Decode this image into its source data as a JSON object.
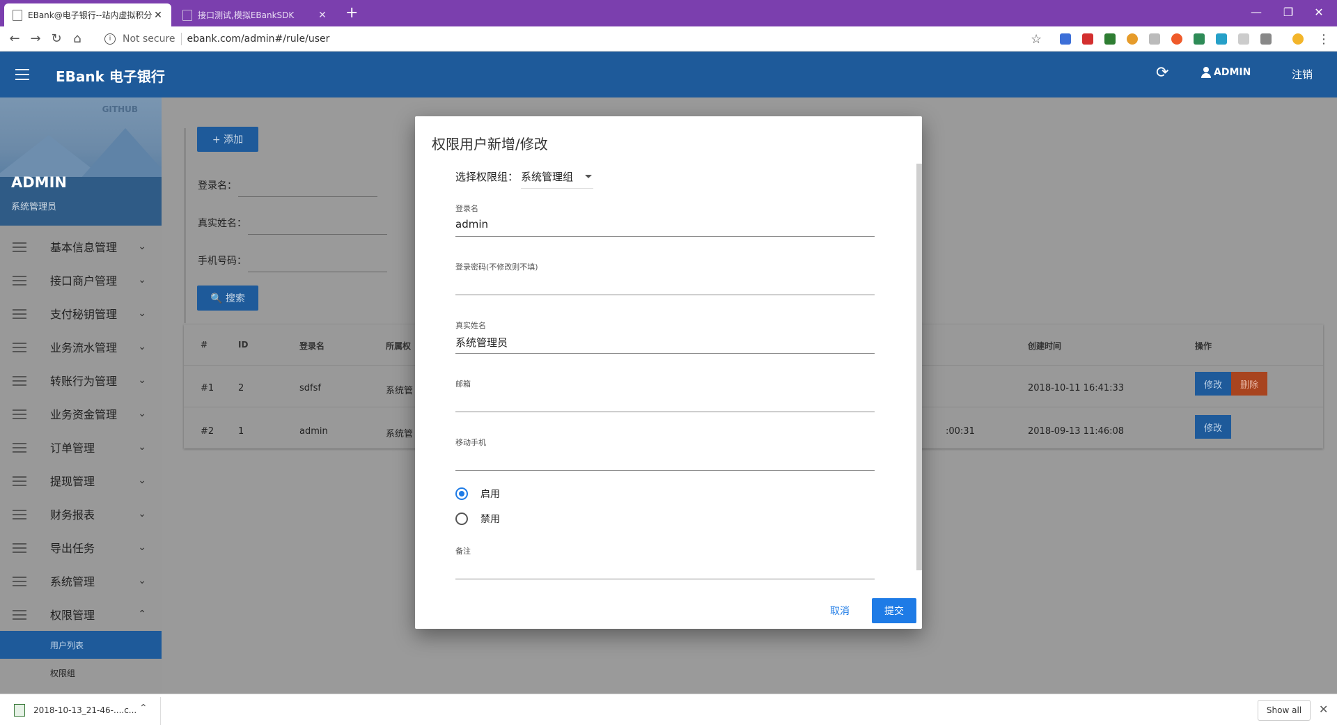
{
  "browser": {
    "tabs": [
      {
        "title": "EBank@电子银行--站内虚拟积分",
        "close": "✕"
      },
      {
        "title": "接口测试,模拟EBankSDK",
        "close": "✕"
      }
    ],
    "new_tab": "+",
    "window_controls": {
      "minimize": "—",
      "restore": "❐",
      "close": "✕"
    },
    "nav": {
      "back": "←",
      "forward": "→",
      "reload": "↻",
      "home": "⌂"
    },
    "security_label": "Not secure",
    "url": "ebank.com/admin#/rule/user",
    "bookmark_star": "☆",
    "menu": "⋮"
  },
  "app": {
    "brand": "EBank 电子银行",
    "user_name": "ADMIN",
    "logout": "注销",
    "refresh_icon": "⟳"
  },
  "sidebar": {
    "github": "GITHUB",
    "profile_name": "ADMIN",
    "profile_role": "系统管理员",
    "menu": [
      {
        "label": "基本信息管理",
        "chevron": "⌄"
      },
      {
        "label": "接口商户管理",
        "chevron": "⌄"
      },
      {
        "label": "支付秘钥管理",
        "chevron": "⌄"
      },
      {
        "label": "业务流水管理",
        "chevron": "⌄"
      },
      {
        "label": "转账行为管理",
        "chevron": "⌄"
      },
      {
        "label": "业务资金管理",
        "chevron": "⌄"
      },
      {
        "label": "订单管理",
        "chevron": "⌄"
      },
      {
        "label": "提现管理",
        "chevron": "⌄"
      },
      {
        "label": "财务报表",
        "chevron": "⌄"
      },
      {
        "label": "导出任务",
        "chevron": "⌄"
      },
      {
        "label": "系统管理",
        "chevron": "⌄"
      },
      {
        "label": "权限管理",
        "chevron": "⌃"
      }
    ],
    "submenu": [
      {
        "label": "用户列表",
        "active": true
      },
      {
        "label": "权限组",
        "active": false
      }
    ]
  },
  "content": {
    "add_button": "+ 添加",
    "search_button": "🔍 搜索",
    "filters": [
      {
        "label": "登录名："
      },
      {
        "label": "真实姓名："
      },
      {
        "label": "手机号码："
      }
    ],
    "table": {
      "headers": [
        "#",
        "ID",
        "登录名",
        "所属权",
        "创建时间",
        "操作"
      ],
      "rows": [
        {
          "num": "#1",
          "id": "2",
          "login": "sdfsf",
          "group": "系统管",
          "partial_time": "",
          "created": "2018-10-11 16:41:33",
          "edit": "修改",
          "delete": "删除"
        },
        {
          "num": "#2",
          "id": "1",
          "login": "admin",
          "group": "系统管",
          "partial_time": ":00:31",
          "created": "2018-09-13 11:46:08",
          "edit": "修改",
          "delete": ""
        }
      ]
    }
  },
  "dialog": {
    "title": "权限用户新增/修改",
    "group_label": "选择权限组：",
    "group_value": "系统管理组",
    "fields": [
      {
        "label": "登录名",
        "value": "admin"
      },
      {
        "label": "登录密码(不修改则不填)",
        "value": ""
      },
      {
        "label": "真实姓名",
        "value": "系统管理员"
      },
      {
        "label": "邮箱",
        "value": ""
      },
      {
        "label": "移动手机",
        "value": ""
      }
    ],
    "status_options": [
      {
        "label": "启用",
        "checked": true
      },
      {
        "label": "禁用",
        "checked": false
      }
    ],
    "remark_label": "备注",
    "remark_value": "",
    "cancel": "取消",
    "submit": "提交"
  },
  "downloads": {
    "file": "2018-10-13_21-46-....c...",
    "caret": "⌃",
    "show_all": "Show all",
    "close": "✕"
  }
}
